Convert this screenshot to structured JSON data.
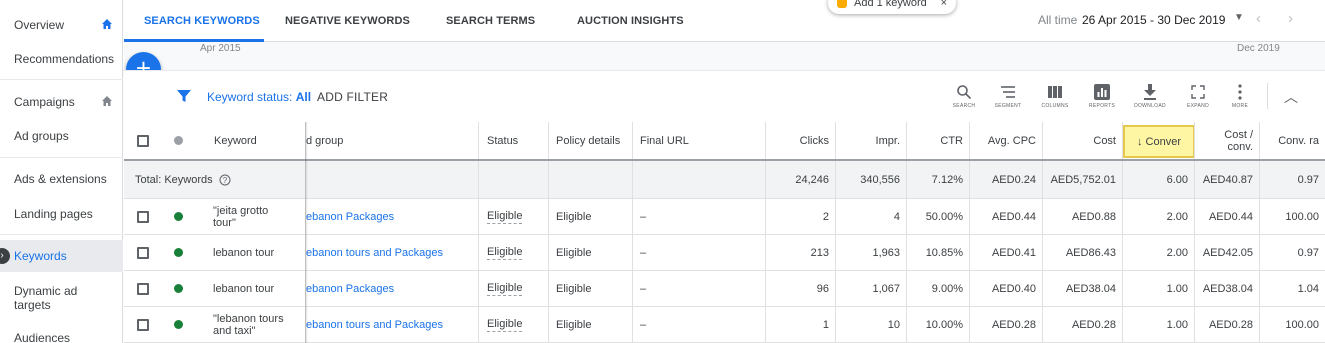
{
  "sidebar": {
    "items": [
      {
        "label": "Overview",
        "home": true
      },
      {
        "label": "Recommendations",
        "home": false
      },
      {
        "label": "Campaigns",
        "home": true
      },
      {
        "label": "Ad groups",
        "home": false
      },
      {
        "label": "Ads & extensions",
        "home": false
      },
      {
        "label": "Landing pages",
        "home": false
      },
      {
        "label": "Keywords",
        "home": false,
        "active": true
      },
      {
        "label": "Dynamic ad targets",
        "home": false
      },
      {
        "label": "Audiences",
        "home": false
      }
    ]
  },
  "tabs": {
    "items": [
      "SEARCH KEYWORDS",
      "NEGATIVE KEYWORDS",
      "SEARCH TERMS",
      "AUCTION INSIGHTS"
    ],
    "active": 0
  },
  "tip": {
    "label": "Add 1 keyword",
    "close": "×"
  },
  "date": {
    "label": "All time",
    "range": "26 Apr 2015 - 30 Dec 2019"
  },
  "timeline": {
    "start": "Apr 2015",
    "end": "Dec 2019"
  },
  "filter": {
    "status_prefix": "Keyword status: ",
    "status_value": "All",
    "add_filter": "ADD FILTER"
  },
  "toolbar": [
    "SEARCH",
    "SEGMENT",
    "COLUMNS",
    "REPORTS",
    "DOWNLOAD",
    "EXPAND",
    "MORE"
  ],
  "table": {
    "headers": {
      "keyword": "Keyword",
      "ad_group": "d group",
      "status": "Status",
      "policy": "Policy details",
      "final_url": "Final URL",
      "clicks": "Clicks",
      "impr": "Impr.",
      "ctr": "CTR",
      "avg_cpc": "Avg. CPC",
      "cost": "Cost",
      "conversions": "Conver",
      "cost_conv": "Cost / conv.",
      "conv_rate": "Conv. ra"
    },
    "total": {
      "label": "Total: Keywords",
      "clicks": "24,246",
      "impr": "340,556",
      "ctr": "7.12%",
      "avg_cpc": "AED0.24",
      "cost": "AED5,752.01",
      "conversions": "6.00",
      "cost_conv": "AED40.87",
      "conv_rate": "0.97"
    },
    "rows": [
      {
        "keyword": "\"jeita grotto tour\"",
        "ad_group": "ebanon Packages",
        "status": "Eligible",
        "policy": "Eligible",
        "final_url": "–",
        "clicks": "2",
        "impr": "4",
        "ctr": "50.00%",
        "avg_cpc": "AED0.44",
        "cost": "AED0.88",
        "conversions": "2.00",
        "cost_conv": "AED0.44",
        "conv_rate": "100.00"
      },
      {
        "keyword": "lebanon tour",
        "ad_group": "ebanon tours and Packages",
        "status": "Eligible",
        "policy": "Eligible",
        "final_url": "–",
        "clicks": "213",
        "impr": "1,963",
        "ctr": "10.85%",
        "avg_cpc": "AED0.41",
        "cost": "AED86.43",
        "conversions": "2.00",
        "cost_conv": "AED42.05",
        "conv_rate": "0.97"
      },
      {
        "keyword": "lebanon tour",
        "ad_group": "ebanon Packages",
        "status": "Eligible",
        "policy": "Eligible",
        "final_url": "–",
        "clicks": "96",
        "impr": "1,067",
        "ctr": "9.00%",
        "avg_cpc": "AED0.40",
        "cost": "AED38.04",
        "conversions": "1.00",
        "cost_conv": "AED38.04",
        "conv_rate": "1.04"
      },
      {
        "keyword": "\"lebanon tours and taxi\"",
        "ad_group": "ebanon tours and Packages",
        "status": "Eligible",
        "policy": "Eligible",
        "final_url": "–",
        "clicks": "1",
        "impr": "10",
        "ctr": "10.00%",
        "avg_cpc": "AED0.28",
        "cost": "AED0.28",
        "conversions": "1.00",
        "cost_conv": "AED0.28",
        "conv_rate": "100.00"
      }
    ]
  },
  "colors": {
    "accent": "#1a73e8",
    "eligible_dot": "#188038",
    "highlight": "#fef6a2"
  }
}
